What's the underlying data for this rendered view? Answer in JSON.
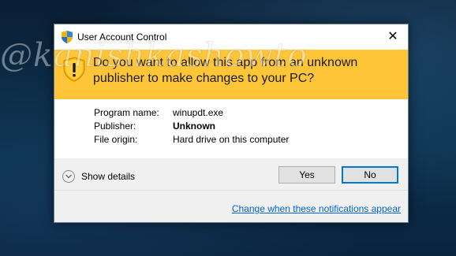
{
  "window": {
    "title": "User Account Control",
    "close_glyph": "✕"
  },
  "banner": {
    "question": "Do you want to allow this app from an unknown publisher to make changes to your PC?",
    "icon": "warning-shield-icon",
    "background_color": "#fdc537"
  },
  "details": [
    {
      "label": "Program name:",
      "value": "winupdt.exe",
      "bold": false
    },
    {
      "label": "Publisher:",
      "value": "Unknown",
      "bold": true
    },
    {
      "label": "File origin:",
      "value": "Hard drive on this computer",
      "bold": false
    }
  ],
  "footer": {
    "show_details_label": "Show details",
    "yes_label": "Yes",
    "no_label": "No",
    "change_link": "Change when these notifications appear"
  },
  "watermark": {
    "text": "@kanishkashowto"
  },
  "colors": {
    "accent": "#0078d7",
    "link": "#0066cc",
    "desktop": "#0b2f4b"
  }
}
